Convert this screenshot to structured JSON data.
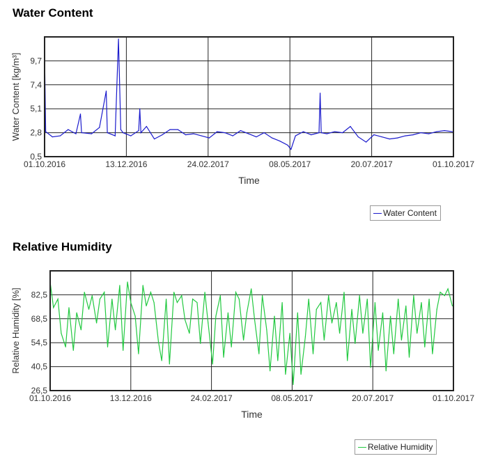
{
  "chart_data": [
    {
      "type": "line",
      "title": "Water Content",
      "xlabel": "Time",
      "ylabel": "Water Content [kg/m³]",
      "xlim": [
        "2016-10-01",
        "2017-10-01"
      ],
      "ylim": [
        0.5,
        12.0
      ],
      "xticks": [
        "2016-10-01",
        "2016-12-13",
        "2017-02-24",
        "2017-05-08",
        "2017-07-20",
        "2017-10-01"
      ],
      "xtick_labels": [
        "01.10.2016",
        "13.12.2016",
        "24.02.2017",
        "08.05.2017",
        "20.07.2017",
        "01.10.2017"
      ],
      "yticks": [
        0.5,
        2.8,
        5.1,
        7.4,
        9.7
      ],
      "ytick_labels": [
        "0,5",
        "2,8",
        "5,1",
        "7,4",
        "9,7"
      ],
      "grid": true,
      "legend": "bottom-right",
      "color": "#1a1acc",
      "series": [
        {
          "name": "Water Content",
          "x": [
            "2016-10-01",
            "2016-10-02",
            "2016-10-08",
            "2016-10-15",
            "2016-10-22",
            "2016-10-29",
            "2016-11-02",
            "2016-11-03",
            "2016-11-12",
            "2016-11-19",
            "2016-11-25",
            "2016-11-26",
            "2016-12-03",
            "2016-12-06",
            "2016-12-08",
            "2016-12-10",
            "2016-12-17",
            "2016-12-24",
            "2016-12-25",
            "2016-12-26",
            "2016-12-31",
            "2017-01-07",
            "2017-01-14",
            "2017-01-21",
            "2017-01-28",
            "2017-02-04",
            "2017-02-11",
            "2017-02-18",
            "2017-02-25",
            "2017-03-04",
            "2017-03-11",
            "2017-03-18",
            "2017-03-25",
            "2017-04-01",
            "2017-04-08",
            "2017-04-15",
            "2017-04-22",
            "2017-04-29",
            "2017-05-06",
            "2017-05-09",
            "2017-05-13",
            "2017-05-20",
            "2017-05-27",
            "2017-06-03",
            "2017-06-04",
            "2017-06-05",
            "2017-06-10",
            "2017-06-17",
            "2017-06-24",
            "2017-07-01",
            "2017-07-08",
            "2017-07-15",
            "2017-07-22",
            "2017-07-29",
            "2017-08-05",
            "2017-08-12",
            "2017-08-19",
            "2017-08-26",
            "2017-09-02",
            "2017-09-09",
            "2017-09-16",
            "2017-09-23",
            "2017-09-30"
          ],
          "values": [
            10.5,
            2.9,
            2.4,
            2.5,
            3.1,
            2.7,
            4.6,
            2.8,
            2.7,
            3.3,
            6.8,
            2.8,
            2.5,
            11.8,
            3.1,
            2.8,
            2.5,
            3.0,
            5.1,
            2.8,
            3.4,
            2.2,
            2.6,
            3.1,
            3.1,
            2.6,
            2.7,
            2.5,
            2.3,
            2.9,
            2.8,
            2.5,
            3.0,
            2.7,
            2.4,
            2.8,
            2.3,
            2.0,
            1.6,
            1.2,
            2.5,
            2.9,
            2.6,
            2.8,
            6.6,
            2.8,
            2.7,
            2.9,
            2.8,
            3.4,
            2.4,
            1.9,
            2.6,
            2.4,
            2.2,
            2.3,
            2.5,
            2.6,
            2.8,
            2.7,
            2.9,
            3.0,
            2.9
          ]
        }
      ]
    },
    {
      "type": "line",
      "title": "Relative Humidity",
      "xlabel": "Time",
      "ylabel": "Relative Humidity [%]",
      "xlim": [
        "2016-10-01",
        "2017-10-01"
      ],
      "ylim": [
        26.5,
        96.5
      ],
      "xticks": [
        "2016-10-01",
        "2016-12-13",
        "2017-02-24",
        "2017-05-08",
        "2017-07-20",
        "2017-10-01"
      ],
      "xtick_labels": [
        "01.10.2016",
        "13.12.2016",
        "24.02.2017",
        "08.05.2017",
        "20.07.2017",
        "01.10.2017"
      ],
      "yticks": [
        26.5,
        40.5,
        54.5,
        68.5,
        82.5
      ],
      "ytick_labels": [
        "26,5",
        "40,5",
        "54,5",
        "68,5",
        "82,5"
      ],
      "grid": true,
      "legend": "bottom-right",
      "color": "#22c940",
      "series": [
        {
          "name": "Relative Humidity",
          "x": [
            "2016-10-01",
            "2016-10-04",
            "2016-10-08",
            "2016-10-11",
            "2016-10-15",
            "2016-10-18",
            "2016-10-22",
            "2016-10-25",
            "2016-10-29",
            "2016-11-01",
            "2016-11-05",
            "2016-11-08",
            "2016-11-12",
            "2016-11-15",
            "2016-11-19",
            "2016-11-22",
            "2016-11-26",
            "2016-11-29",
            "2016-12-03",
            "2016-12-06",
            "2016-12-10",
            "2016-12-13",
            "2016-12-17",
            "2016-12-20",
            "2016-12-24",
            "2016-12-27",
            "2016-12-31",
            "2017-01-03",
            "2017-01-07",
            "2017-01-10",
            "2017-01-14",
            "2017-01-17",
            "2017-01-21",
            "2017-01-24",
            "2017-01-28",
            "2017-01-31",
            "2017-02-04",
            "2017-02-07",
            "2017-02-11",
            "2017-02-14",
            "2017-02-18",
            "2017-02-21",
            "2017-02-25",
            "2017-02-28",
            "2017-03-04",
            "2017-03-07",
            "2017-03-11",
            "2017-03-14",
            "2017-03-18",
            "2017-03-21",
            "2017-03-25",
            "2017-03-28",
            "2017-04-01",
            "2017-04-04",
            "2017-04-08",
            "2017-04-11",
            "2017-04-15",
            "2017-04-18",
            "2017-04-22",
            "2017-04-25",
            "2017-04-29",
            "2017-05-02",
            "2017-05-06",
            "2017-05-09",
            "2017-05-13",
            "2017-05-16",
            "2017-05-20",
            "2017-05-23",
            "2017-05-27",
            "2017-05-30",
            "2017-06-03",
            "2017-06-06",
            "2017-06-10",
            "2017-06-13",
            "2017-06-17",
            "2017-06-20",
            "2017-06-24",
            "2017-06-27",
            "2017-07-01",
            "2017-07-04",
            "2017-07-08",
            "2017-07-11",
            "2017-07-15",
            "2017-07-18",
            "2017-07-22",
            "2017-07-25",
            "2017-07-29",
            "2017-08-01",
            "2017-08-05",
            "2017-08-08",
            "2017-08-12",
            "2017-08-15",
            "2017-08-19",
            "2017-08-22",
            "2017-08-26",
            "2017-08-29",
            "2017-09-02",
            "2017-09-05",
            "2017-09-09",
            "2017-09-12",
            "2017-09-16",
            "2017-09-19",
            "2017-09-23",
            "2017-09-26",
            "2017-09-30"
          ],
          "values": [
            90,
            75,
            80,
            60,
            52,
            75,
            50,
            72,
            62,
            84,
            74,
            82,
            66,
            80,
            84,
            52,
            80,
            62,
            88,
            50,
            90,
            78,
            70,
            48,
            88,
            76,
            84,
            78,
            55,
            44,
            80,
            42,
            84,
            78,
            82,
            68,
            60,
            80,
            78,
            54,
            84,
            66,
            42,
            70,
            82,
            46,
            72,
            52,
            84,
            80,
            56,
            72,
            86,
            68,
            48,
            82,
            62,
            38,
            70,
            44,
            78,
            36,
            60,
            30,
            72,
            36,
            58,
            80,
            48,
            74,
            78,
            56,
            82,
            66,
            78,
            60,
            84,
            44,
            74,
            54,
            82,
            60,
            80,
            40,
            78,
            50,
            72,
            38,
            70,
            48,
            80,
            56,
            76,
            46,
            82,
            60,
            78,
            52,
            80,
            48,
            74,
            84,
            82,
            86,
            76
          ]
        }
      ]
    }
  ]
}
